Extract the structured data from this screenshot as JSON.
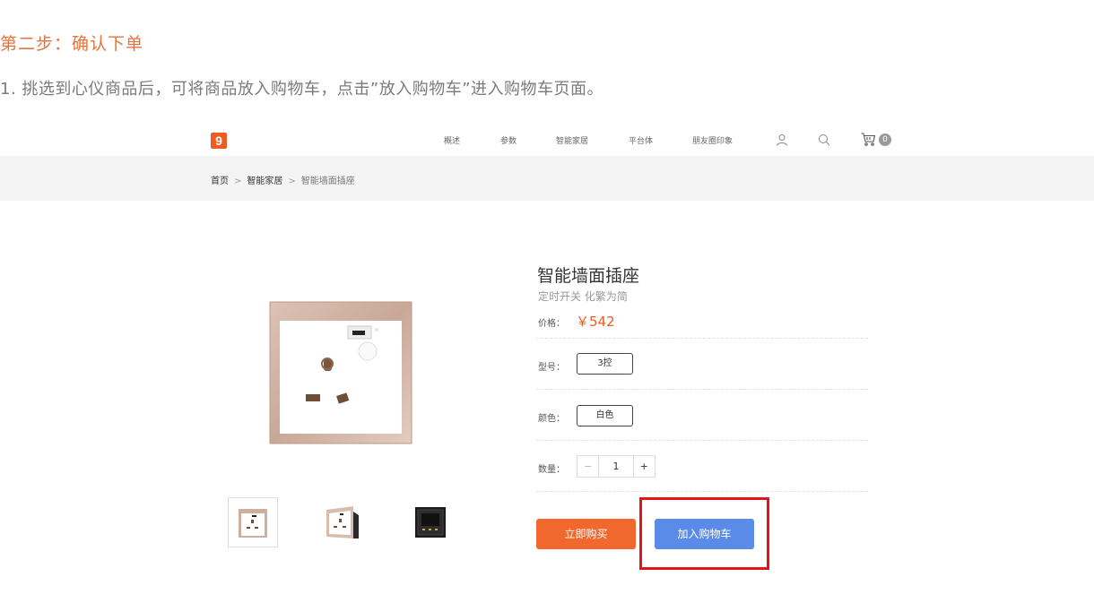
{
  "instruction": {
    "title": "第二步：确认下单",
    "description": "1. 挑选到心仪商品后，可将商品放入购物车，点击”放入购物车”进入购物车页面。"
  },
  "header": {
    "logo_text": "9",
    "nav": [
      "概述",
      "参数",
      "智能家居",
      "平台体",
      "朋友圈印象"
    ],
    "icons": [
      "user-icon",
      "search-icon",
      "cart-icon"
    ],
    "cart_count": "0"
  },
  "breadcrumb": {
    "home": "首页",
    "sep1": ">",
    "category": "智能家居",
    "sep2": ">",
    "current": "智能墙面插座"
  },
  "product": {
    "title": "智能墙面插座",
    "subtitle": "定时开关  化繁为简",
    "price_label": "价格：",
    "price": "￥542",
    "model_label": "型号：",
    "model_value": "3控",
    "color_label": "颜色：",
    "color_value": "白色",
    "qty_label": "数量：",
    "qty_minus": "−",
    "qty_value": "1",
    "qty_plus": "+",
    "buy_now": "立即购买",
    "add_to_cart": "加入购物车"
  },
  "colors": {
    "accent_orange": "#f0682e",
    "cart_blue": "#5b8be8",
    "highlight_red": "#e4141c",
    "price_orange": "#f05a23"
  }
}
